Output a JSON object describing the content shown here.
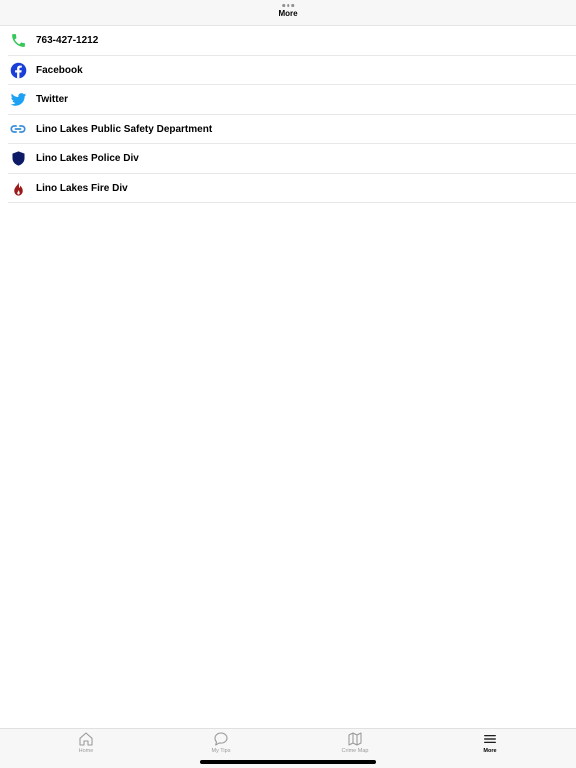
{
  "header": {
    "title": "More"
  },
  "list": {
    "items": [
      {
        "label": "763-427-1212",
        "icon": "phone-icon",
        "color": "#34c759"
      },
      {
        "label": "Facebook",
        "icon": "facebook-icon",
        "color": "#1a3ed8"
      },
      {
        "label": "Twitter",
        "icon": "twitter-icon",
        "color": "#1da1f2"
      },
      {
        "label": "Lino Lakes Public Safety Department",
        "icon": "link-icon",
        "color": "#3a8fd8"
      },
      {
        "label": "Lino Lakes Police Div",
        "icon": "shield-icon",
        "color": "#0d1a66"
      },
      {
        "label": "Lino Lakes Fire Div",
        "icon": "flame-icon",
        "color": "#9b1b1b"
      }
    ]
  },
  "tabs": {
    "items": [
      {
        "label": "Home",
        "icon": "home-icon"
      },
      {
        "label": "My Tips",
        "icon": "chat-bubble-icon"
      },
      {
        "label": "Crime Map",
        "icon": "map-icon"
      },
      {
        "label": "More",
        "icon": "menu-icon"
      }
    ],
    "active": "More"
  }
}
